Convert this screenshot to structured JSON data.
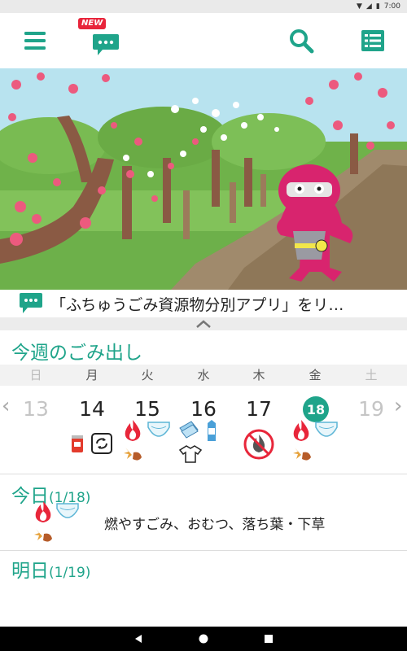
{
  "status_bar": {
    "time": "7:00"
  },
  "header": {
    "menu_icon": "hamburger-menu-icon",
    "new_badge": "NEW",
    "chat_icon": "chat-bubble-icon",
    "search_icon": "search-icon",
    "list_icon": "list-icon"
  },
  "notice": {
    "text": "「ふちゅうごみ資源物分別アプリ」をリ…"
  },
  "week": {
    "title": "今週のごみ出し",
    "day_headers": [
      "日",
      "月",
      "火",
      "水",
      "木",
      "金",
      "土"
    ],
    "dates": [
      "13",
      "14",
      "15",
      "16",
      "17",
      "18",
      "19"
    ],
    "today_index": 5
  },
  "today": {
    "label": "今日",
    "date": "(1/18)",
    "description": "燃やすごみ、おむつ、落ち葉・下草"
  },
  "tomorrow": {
    "label": "明日",
    "date": "(1/19)"
  },
  "colors": {
    "accent": "#1fa48a",
    "new_badge": "#e8253b"
  }
}
